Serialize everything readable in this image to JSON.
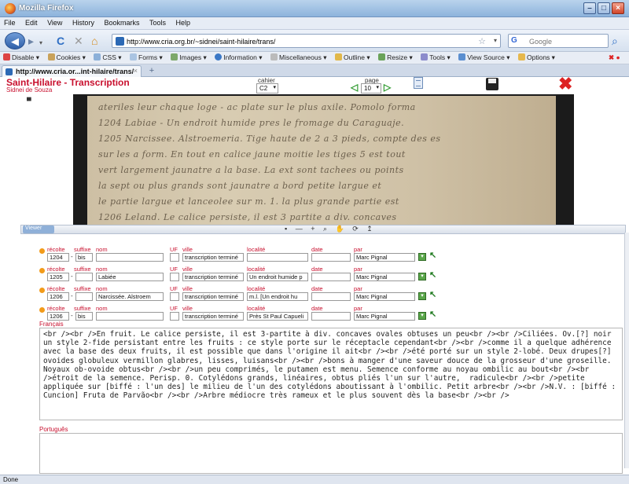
{
  "window": {
    "title": "Mozilla Firefox"
  },
  "menubar": [
    "File",
    "Edit",
    "View",
    "History",
    "Bookmarks",
    "Tools",
    "Help"
  ],
  "nav": {
    "url": "http://www.cria.org.br/~sidnei/saint-hilaire/trans/",
    "search_placeholder": "Google"
  },
  "devbar": [
    "Disable",
    "Cookies",
    "CSS",
    "Forms",
    "Images",
    "Information",
    "Miscellaneous",
    "Outline",
    "Resize",
    "Tools",
    "View Source",
    "Options"
  ],
  "tab": {
    "label": "http://www.cria.or...int-hilaire/trans/"
  },
  "app": {
    "title": "Saint-Hilaire",
    "separator": " - ",
    "section": "Transcription",
    "user": "Sidnei de Souza",
    "cahier_label": "cahier",
    "cahier_value": "C2",
    "page_label": "page",
    "page_value": "10"
  },
  "manuscript": {
    "lines": [
      "ateriles leur chaque loge - ac plate sur le plus axile. Pomolo forma",
      "1204 Labiae - Un endroit humide pres le fromage du Caraguaje.",
      "1205 Narcissee. Alstroemeria. Tige haute de 2 a 3 pieds, compte des es",
      "sur les a form. En tout en calice jaune moitie les tiges 5 est tout",
      "vert largement jaunatre a la base. La ext sont tachees ou points",
      "la sept ou plus grands sont jaunatre a bord petite largue et",
      "le partie largue et lanceolee sur m. 1. la plus grande partie est",
      "1206 Leland. Le calice persiste, il est 3 partite a div. concaves"
    ]
  },
  "viewer": {
    "tab_label": "Viewer",
    "tools": "▪ — + ⌕ ✋ ⟳ ↥"
  },
  "records": [
    {
      "recolte_label": "récolte",
      "suffix_label": "suffixe",
      "nom_label": "nom",
      "uf_label": "UF",
      "ville_label": "ville",
      "localite_label": "localité",
      "date_label": "date",
      "par_label": "par",
      "recolte": "1204",
      "suffix": "bis",
      "nom": "",
      "uf": "",
      "ville": "transcription terminé",
      "localite": "",
      "date": "",
      "par": "Marc Pignal"
    },
    {
      "recolte_label": "récolte",
      "suffix_label": "suffixe",
      "nom_label": "nom",
      "uf_label": "UF",
      "ville_label": "ville",
      "localite_label": "localité",
      "date_label": "date",
      "par_label": "par",
      "recolte": "1205",
      "suffix": "",
      "nom": "Labiée",
      "uf": "",
      "ville": "transcription terminé",
      "localite": "Un endroit humide p",
      "date": "",
      "par": "Marc Pignal"
    },
    {
      "recolte_label": "récolte",
      "suffix_label": "suffixe",
      "nom_label": "nom",
      "uf_label": "UF",
      "ville_label": "ville",
      "localite_label": "localité",
      "date_label": "date",
      "par_label": "par",
      "recolte": "1206",
      "suffix": "",
      "nom": "Narcissée. Alstroem",
      "uf": "",
      "ville": "transcription terminé",
      "localite": "m.l. [Un endroit hu",
      "date": "",
      "par": "Marc Pignal"
    },
    {
      "recolte_label": "récolte",
      "suffix_label": "suffixe",
      "nom_label": "nom",
      "uf_label": "UF",
      "ville_label": "ville",
      "localite_label": "localité",
      "date_label": "date",
      "par_label": "par",
      "recolte": "1206",
      "suffix": "bis",
      "nom": "",
      "uf": "",
      "ville": "transcription terminé",
      "localite": "Près St Paul Capueli",
      "date": "",
      "par": "Marc Pignal"
    }
  ],
  "francais": {
    "label": "Français",
    "text": "<br /><br />En fruit. Le calice persiste, il est 3-partite à div. concaves ovales obtuses un peu<br /><br />Ciliées. Ov.[?] noir un style 2-fide persistant entre les fruits : ce style porte sur le réceptacle cependant<br /><br />comme il a quelque adhérence avec la base des deux fruits, il est possible que dans l'origine il ait<br /><br />été porté sur un style 2-lobé. Deux drupes[?] ovoides globuleux vermillon glabres, lisses, luisans<br /><br />bons à manger d'une saveur douce de la grosseur d'une groseille. Noyaux ob-ovoide obtus<br /><br />un peu comprimés, le putamen est menu. Semence conforme au noyau ombilic au bout<br /><br />étroit de la semence. Perisp. 0. Cotylédons grands, linéaires, obtus pliés l'un sur l'autre,  radicule<br /><br />petite appliquée sur [biffé : l'un des] le milieu de l'un des cotylédons aboutissant à l'ombilic. Petit arbre<br /><br />N.V. : [biffé : Cuncion] Fruta de Parvão<br /><br />Arbre médiocre très rameux et le plus souvent dès la base<br /><br />"
  },
  "portugues": {
    "label": "Português",
    "text": ""
  },
  "status": {
    "text": "Done"
  }
}
